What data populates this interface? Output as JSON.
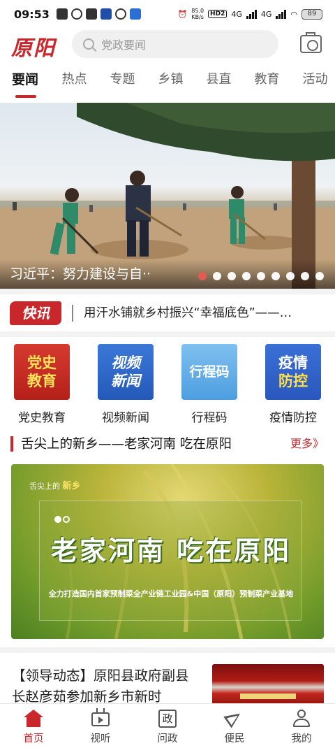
{
  "status_bar": {
    "time": "09:53",
    "speed_value": "85.0",
    "speed_unit": "KB/s",
    "hd_label": "HD",
    "hd_index": "2",
    "network_1": "4G",
    "network_2": "4G",
    "battery": "89"
  },
  "header": {
    "logo_text": "原阳",
    "search_placeholder": "党政要闻"
  },
  "tabs": [
    "要闻",
    "热点",
    "专题",
    "乡镇",
    "县直",
    "教育",
    "活动"
  ],
  "banner": {
    "caption": "习近平：努力建设与自··",
    "slide_count": 9,
    "active_slide": 0
  },
  "news_flash": {
    "badge": "快讯",
    "text": "用汗水铺就乡村振兴“幸福底色”——…"
  },
  "quick_entries": [
    {
      "icon_text_1": "党史",
      "icon_text_2": "教育",
      "label": "党史教育",
      "style": "red"
    },
    {
      "icon_text_1": "视频",
      "icon_text_2": "新闻",
      "label": "视频新闻",
      "style": "blue"
    },
    {
      "icon_text_1": "行程码",
      "icon_text_2": "",
      "label": "行程码",
      "style": "light"
    },
    {
      "icon_text_1": "疫情",
      "icon_text_2": "防控",
      "label": "疫情防控",
      "style": "blue2"
    }
  ],
  "section": {
    "title": "舌尖上的新乡——老家河南 吃在原阳",
    "more": "更多》"
  },
  "promo": {
    "top_label": "舌尖上的",
    "top_brand": "新乡",
    "headline": "老家河南  吃在原阳",
    "sub": "全力打造国内首家预制菜全产业链工业园&中国（原阳）预制菜产业基地"
  },
  "article": {
    "title": "【领导动态】原阳县政府副县长赵彦茹参加新乡市新时"
  },
  "bottom_nav": [
    {
      "label": "首页",
      "icon": "home-icon",
      "active": true
    },
    {
      "label": "视听",
      "icon": "tv-icon",
      "active": false
    },
    {
      "label": "问政",
      "icon": "zheng-icon",
      "icon_text": "政",
      "active": false
    },
    {
      "label": "便民",
      "icon": "send-icon",
      "active": false
    },
    {
      "label": "我的",
      "icon": "user-icon",
      "active": false
    }
  ],
  "colors": {
    "brand_red": "#c9272c",
    "active_dot": "#e25b52"
  }
}
